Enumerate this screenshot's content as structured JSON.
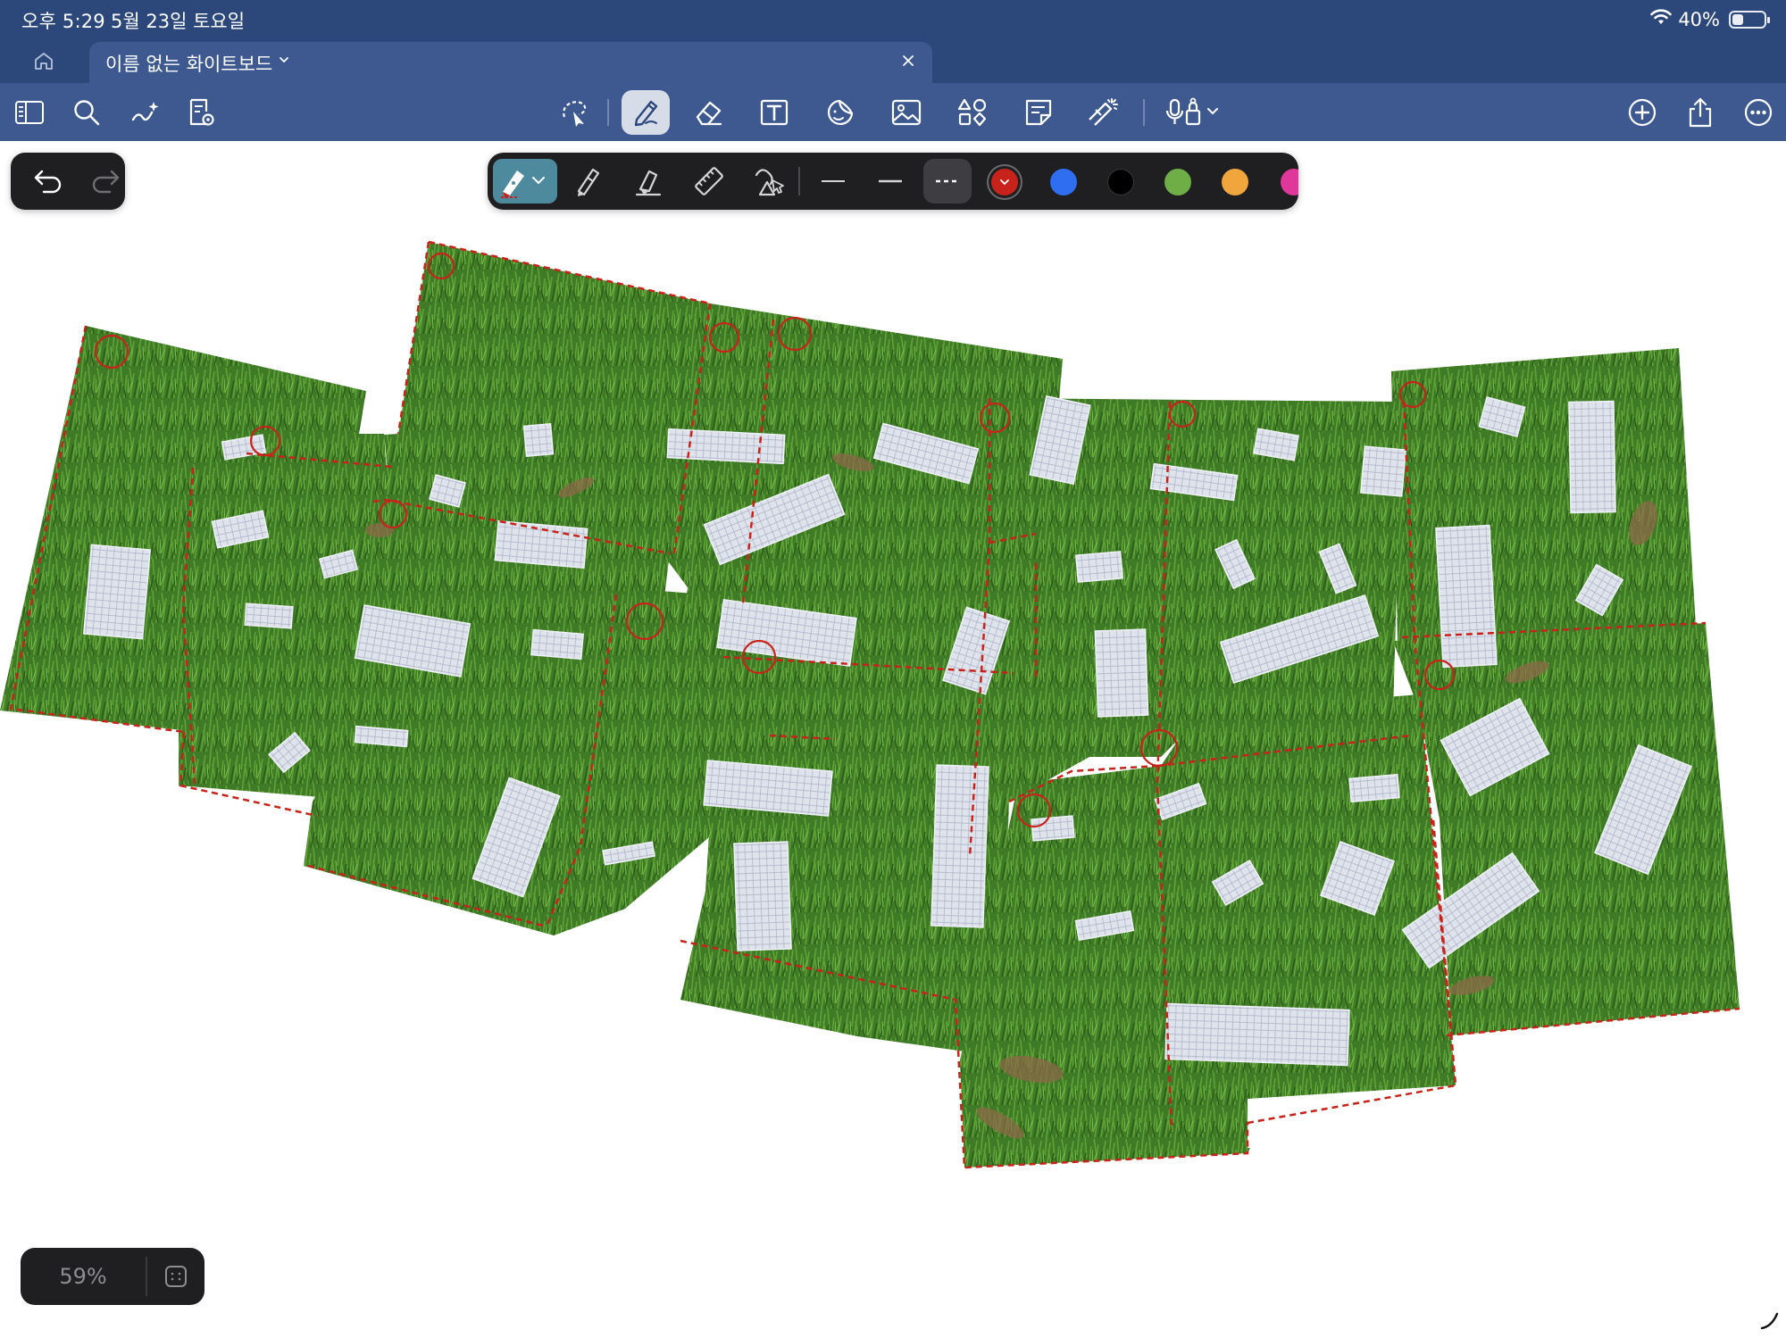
{
  "status_bar": {
    "time": "오후 5:29",
    "date": "5월 23일 토요일",
    "battery": "40%",
    "icons": [
      "wifi-icon",
      "battery-icon"
    ]
  },
  "tabs": {
    "home_icon": "home-icon",
    "document_title": "이름 없는 화이트보드",
    "close_icon": "close-icon"
  },
  "toolbar": {
    "left": [
      "sidebar-icon",
      "search-icon",
      "magic-pen-icon",
      "page-settings-icon"
    ],
    "center": [
      "lasso-icon",
      "pen-icon",
      "eraser-icon",
      "text-box-icon",
      "sticker-icon",
      "image-icon",
      "shapes-icon",
      "sticky-note-icon",
      "laser-pointer-icon",
      "microphone-icon"
    ],
    "active": "pen-icon",
    "right": [
      "add-icon",
      "share-icon",
      "more-icon"
    ]
  },
  "undo_panel": {
    "icons": [
      "undo-icon",
      "redo-icon"
    ]
  },
  "pen_panel": {
    "tools": [
      "fountain-pen-icon",
      "ballpoint-pen-icon",
      "highlighter-icon",
      "ruler-icon",
      "shape-recognition-icon"
    ],
    "stroke_styles": [
      "solid-thin",
      "solid",
      "dashed"
    ],
    "selected_stroke": "dashed",
    "colors": [
      "#c8231b",
      "#2f6ef0",
      "#000000",
      "#6fae46",
      "#f0a63c",
      "#e0389a"
    ],
    "selected_color": "#c8231b"
  },
  "zoom": {
    "level": "59%",
    "fit_icon": "fit-to-screen-icon"
  },
  "canvas": {
    "content": "photo-collage-grass-with-paper-scraps",
    "dashed_outline_color": "#c8231b"
  }
}
